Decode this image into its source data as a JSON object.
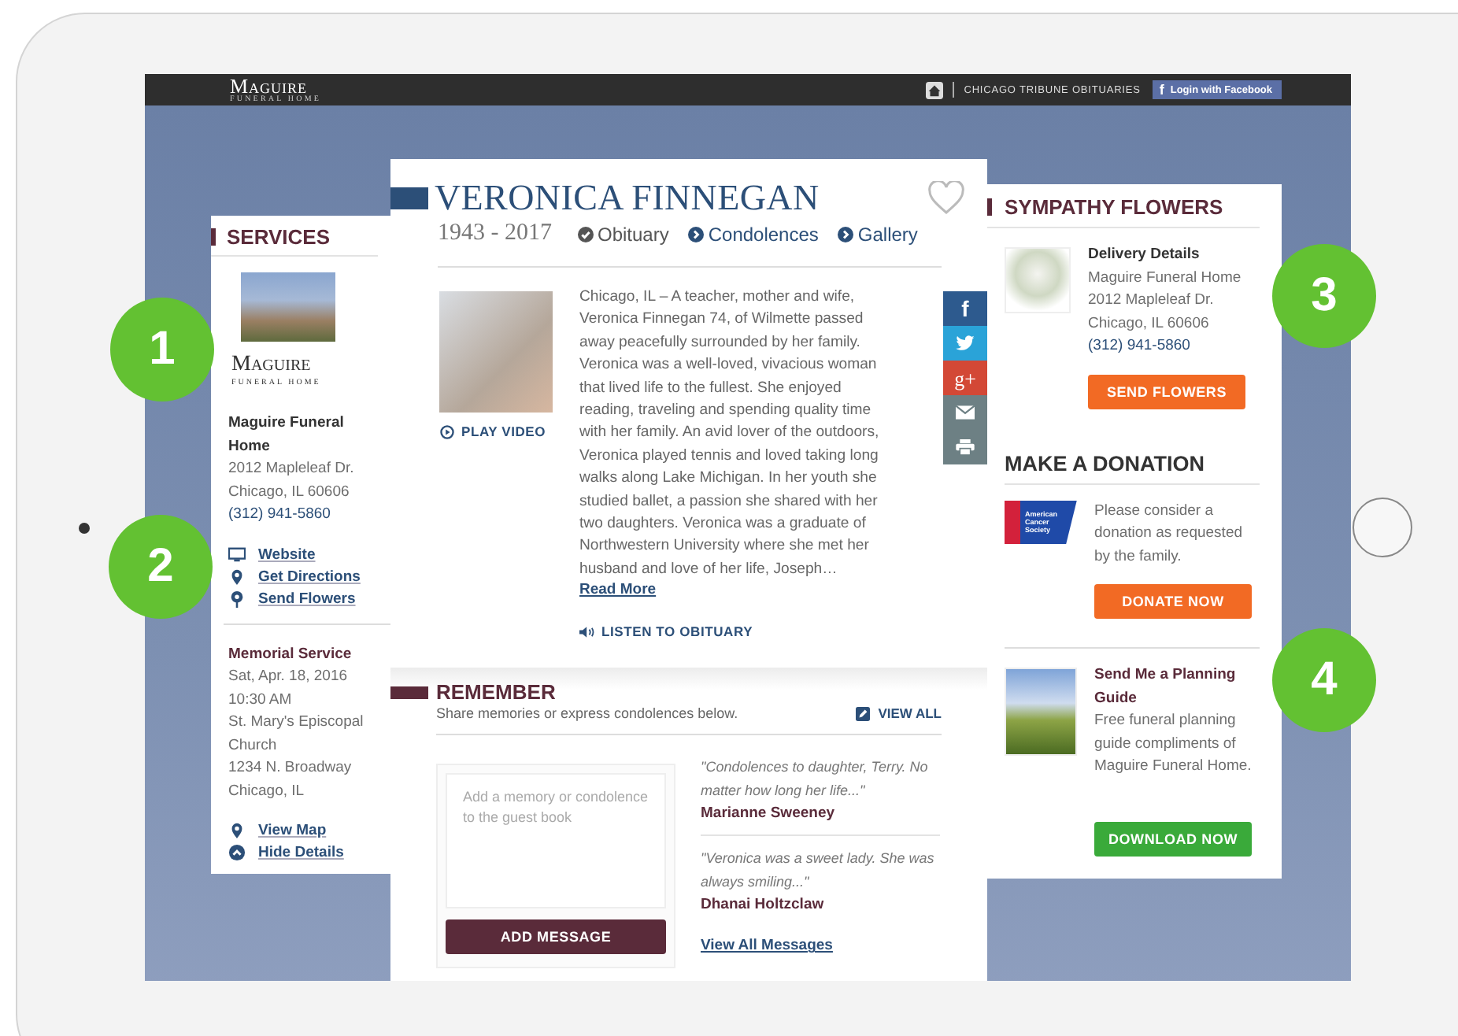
{
  "header": {
    "logo_name": "Maguire",
    "logo_sub": "FUNERAL HOME",
    "link": "CHICAGO TRIBUNE OBITUARIES",
    "facebook_glyph": "f",
    "facebook_button": "Login with Facebook"
  },
  "services": {
    "title": "SERVICES",
    "logo_name": "Maguire",
    "logo_sub": "FUNERAL HOME",
    "home_name": "Maguire Funeral Home",
    "address": [
      "2012 Mapleleaf Dr.",
      "Chicago, IL 60606"
    ],
    "phone": "(312) 941-5860",
    "links": [
      {
        "kind": "website",
        "label": "Website"
      },
      {
        "kind": "directions",
        "label": "Get Directions"
      },
      {
        "kind": "flowers",
        "label": "Send Flowers"
      }
    ],
    "event_title": "Memorial Service",
    "event_lines": [
      "Sat, Apr. 18, 2016",
      "10:30 AM",
      "St. Mary's Episcopal Church",
      "1234 N. Broadway",
      "Chicago, IL"
    ],
    "event_links": [
      {
        "kind": "map",
        "label": "View Map"
      },
      {
        "kind": "hide",
        "label": "Hide Details"
      }
    ]
  },
  "obituary": {
    "name": "VERONICA FINNEGAN",
    "dates": "1943 - 2017",
    "nav": [
      {
        "label": "Obituary",
        "selected": true
      },
      {
        "label": "Condolences",
        "selected": false
      },
      {
        "label": "Gallery",
        "selected": false
      }
    ],
    "play_video": "PLAY VIDEO",
    "text": "Chicago, IL – A teacher, mother and wife, Veronica Finnegan 74, of Wilmette passed away peacefully surrounded by her family. Veronica was a well-loved, vivacious woman that lived life to the fullest.  She enjoyed reading, traveling and spending quality time with her family. An avid lover of the outdoors, Veronica played tennis and loved taking long walks along Lake Michigan. In her youth she studied ballet, a passion she shared with her two daughters. Veronica was a graduate of Northwestern University where she met her husband and love of her life, Joseph…",
    "read_more": "Read More",
    "listen": "LISTEN TO OBITUARY",
    "share": [
      {
        "kind": "facebook",
        "glyph": "f",
        "color": "#2d5a8e"
      },
      {
        "kind": "twitter",
        "color": "#2aa3d8"
      },
      {
        "kind": "google",
        "glyph": "g+",
        "color": "#d34836"
      },
      {
        "kind": "email",
        "color": "#6d8084"
      },
      {
        "kind": "print",
        "color": "#6d8084"
      }
    ]
  },
  "remember": {
    "title": "REMEMBER",
    "subtitle": "Share memories or express condolences below.",
    "view_all": "VIEW ALL",
    "placeholder": "Add a memory or condolence to the guest book",
    "add_button": "ADD MESSAGE",
    "messages": [
      {
        "quote": "\"Condolences to daughter, Terry. No matter how long her life...\"",
        "author": "Marianne Sweeney"
      },
      {
        "quote": "\"Veronica was a sweet lady. She was always smiling...\"",
        "author": "Dhanai Holtzclaw"
      }
    ],
    "view_all_messages": "View All Messages"
  },
  "flowers": {
    "title": "SYMPATHY FLOWERS",
    "details_title": "Delivery Details",
    "lines": [
      "Maguire Funeral Home",
      "2012 Mapleleaf Dr.",
      "Chicago, IL 60606"
    ],
    "phone": "(312) 941-5860",
    "button": "SEND FLOWERS"
  },
  "donation": {
    "title": "MAKE A DONATION",
    "logo_text": "American Cancer Society",
    "text": "Please consider a donation as requested by the family.",
    "button": "DONATE NOW"
  },
  "guide": {
    "title": "Send Me a Planning Guide",
    "text": "Free funeral planning guide compliments of Maguire Funeral Home.",
    "button": "DOWNLOAD NOW"
  },
  "callouts": [
    "1",
    "2",
    "3",
    "4"
  ]
}
